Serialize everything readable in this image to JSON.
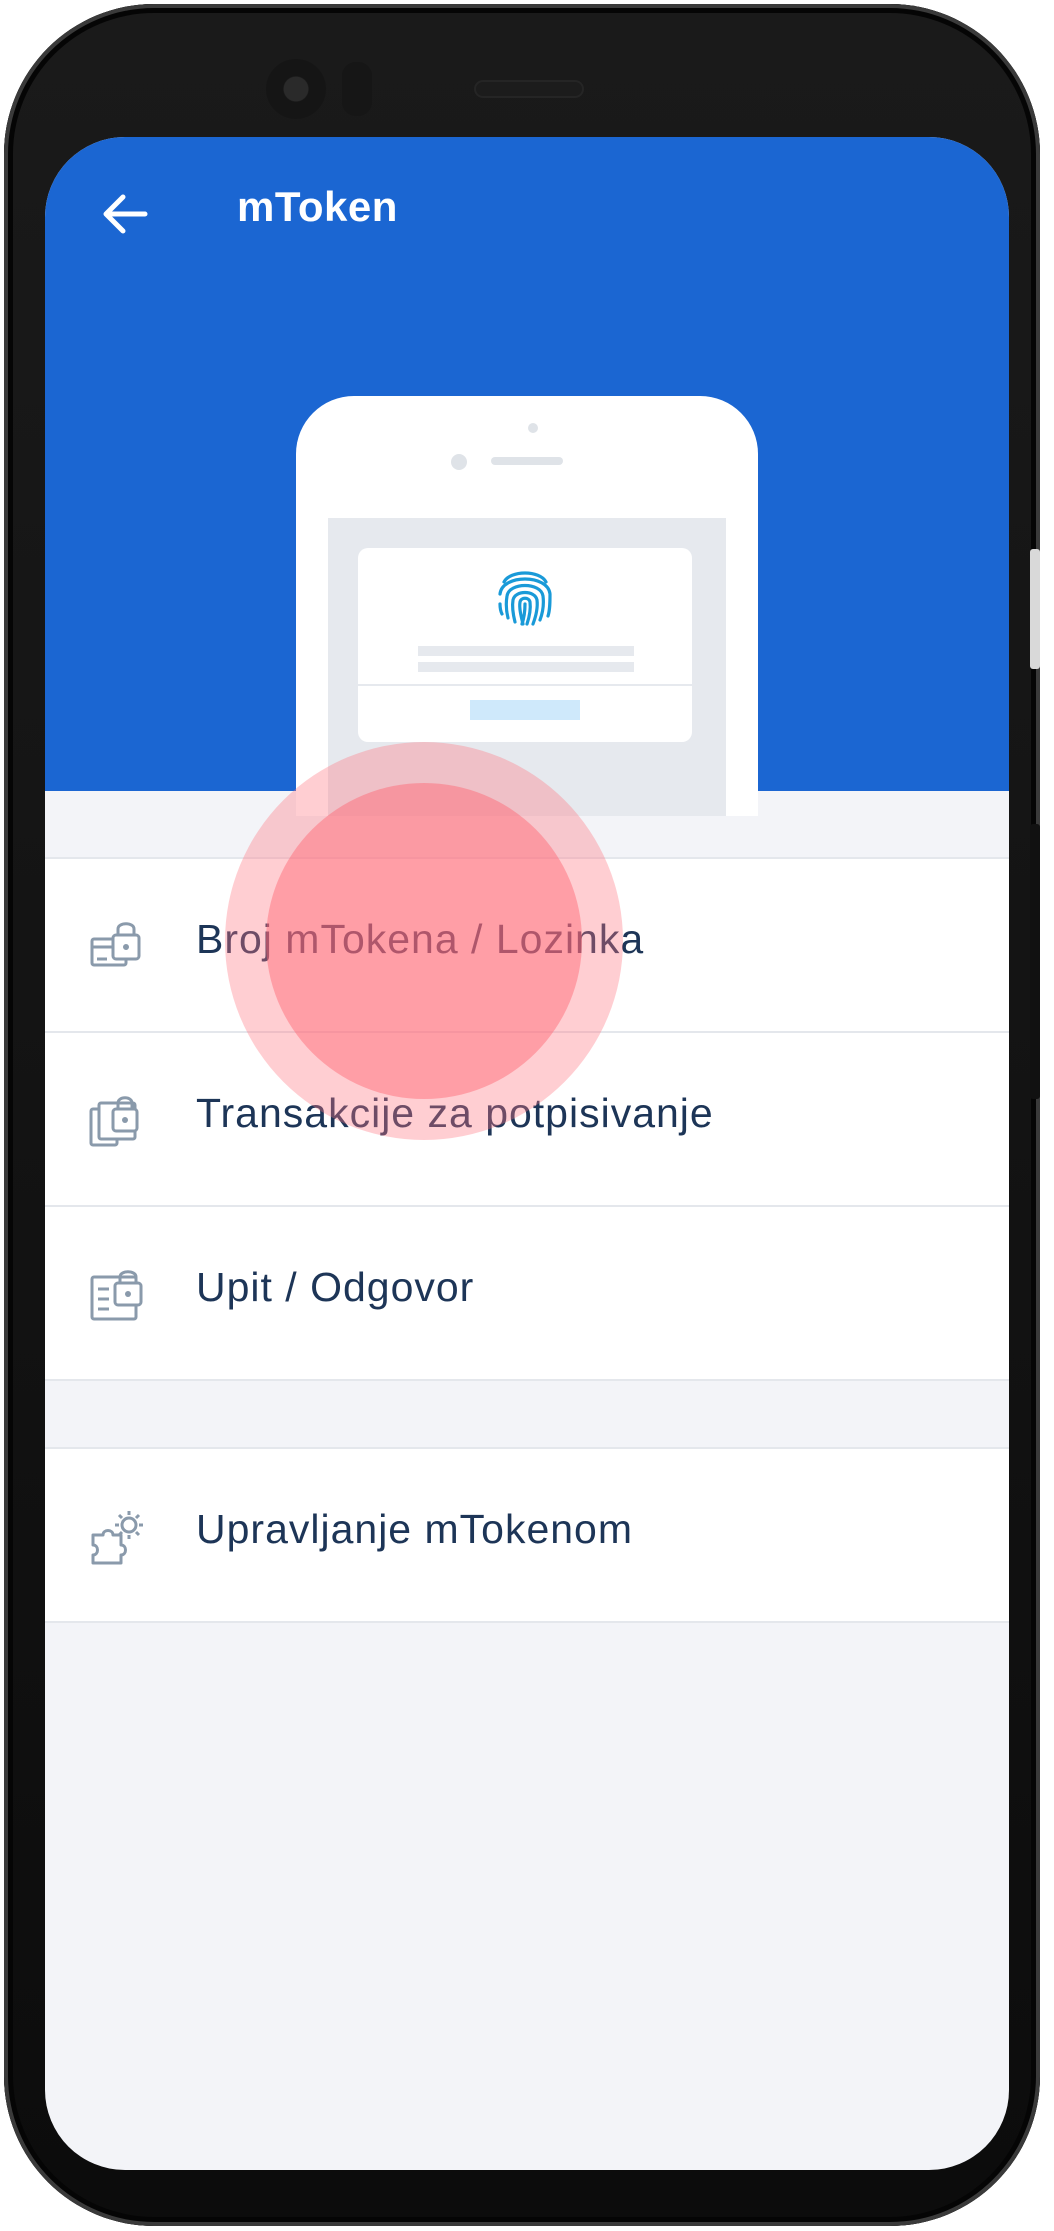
{
  "app": {
    "title": "mToken",
    "back_icon": "arrow-left-icon",
    "accent_color": "#1b66d2"
  },
  "illustration": {
    "icon": "fingerprint-icon",
    "fingerprint_color": "#1a9ad8"
  },
  "menu": {
    "group1": [
      {
        "label": "Broj mTokena / Lozinka",
        "icon": "card-lock-icon"
      },
      {
        "label": "Transakcije za potpisivanje",
        "icon": "documents-lock-icon"
      },
      {
        "label": "Upit / Odgovor",
        "icon": "form-lock-icon"
      }
    ],
    "group2": [
      {
        "label": "Upravljanje mTokenom",
        "icon": "puzzle-gear-icon"
      }
    ]
  },
  "tap_indicator": {
    "target": "Broj mTokena / Lozinka"
  }
}
